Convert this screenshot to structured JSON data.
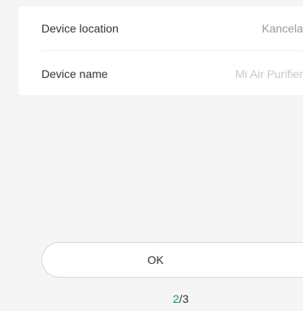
{
  "settings": {
    "rows": [
      {
        "label": "Device location",
        "value": "Kancela"
      },
      {
        "label": "Device name",
        "value": "Mi Air Purifier"
      }
    ]
  },
  "confirm": {
    "ok_label": "OK"
  },
  "pager": {
    "current": "2",
    "separator": "/",
    "total": "3"
  },
  "colors": {
    "accent": "#14a24a",
    "background": "#f5f5f5",
    "card": "#ffffff"
  }
}
